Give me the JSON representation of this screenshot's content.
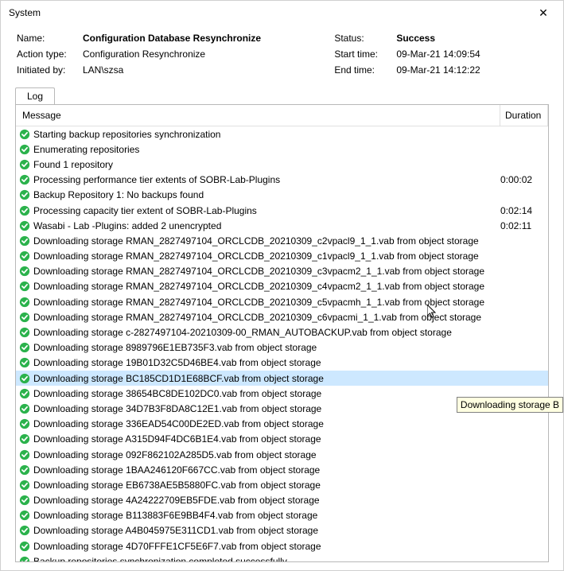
{
  "window": {
    "title": "System",
    "close": "✕"
  },
  "info": {
    "name_label": "Name:",
    "name_value": "Configuration Database Resynchronize",
    "action_label": "Action type:",
    "action_value": "Configuration Resynchronize",
    "init_label": "Initiated by:",
    "init_value": "LAN\\szsa",
    "status_label": "Status:",
    "status_value": "Success",
    "start_label": "Start time:",
    "start_value": "09-Mar-21 14:09:54",
    "end_label": "End time:",
    "end_value": "09-Mar-21 14:12:22"
  },
  "tab": {
    "label": "Log"
  },
  "columns": {
    "message": "Message",
    "duration": "Duration"
  },
  "rows": [
    {
      "msg": "Starting backup repositories synchronization",
      "dur": ""
    },
    {
      "msg": "Enumerating repositories",
      "dur": ""
    },
    {
      "msg": "Found 1 repository",
      "dur": ""
    },
    {
      "msg": "Processing performance tier extents of SOBR-Lab-Plugins",
      "dur": "0:00:02"
    },
    {
      "msg": "Backup Repository 1: No backups found",
      "dur": ""
    },
    {
      "msg": "Processing capacity tier extent of SOBR-Lab-Plugins",
      "dur": "0:02:14"
    },
    {
      "msg": "Wasabi - Lab -Plugins: added 2 unencrypted",
      "dur": "0:02:11"
    },
    {
      "msg": "Downloading storage RMAN_2827497104_ORCLCDB_20210309_c2vpacl9_1_1.vab from object storage",
      "dur": ""
    },
    {
      "msg": "Downloading storage RMAN_2827497104_ORCLCDB_20210309_c1vpacl9_1_1.vab from object storage",
      "dur": ""
    },
    {
      "msg": "Downloading storage RMAN_2827497104_ORCLCDB_20210309_c3vpacm2_1_1.vab from object storage",
      "dur": ""
    },
    {
      "msg": "Downloading storage RMAN_2827497104_ORCLCDB_20210309_c4vpacm2_1_1.vab from object storage",
      "dur": ""
    },
    {
      "msg": "Downloading storage RMAN_2827497104_ORCLCDB_20210309_c5vpacmh_1_1.vab from object storage",
      "dur": ""
    },
    {
      "msg": "Downloading storage RMAN_2827497104_ORCLCDB_20210309_c6vpacmi_1_1.vab from object storage",
      "dur": ""
    },
    {
      "msg": "Downloading storage c-2827497104-20210309-00_RMAN_AUTOBACKUP.vab from object storage",
      "dur": ""
    },
    {
      "msg": "Downloading storage 8989796E1EB735F3.vab from object storage",
      "dur": ""
    },
    {
      "msg": "Downloading storage 19B01D32C5D46BE4.vab from object storage",
      "dur": ""
    },
    {
      "msg": "Downloading storage BC185CD1D1E68BCF.vab from object storage",
      "dur": "",
      "selected": true
    },
    {
      "msg": "Downloading storage 38654BC8DE102DC0.vab from object storage",
      "dur": ""
    },
    {
      "msg": "Downloading storage 34D7B3F8DA8C12E1.vab from object storage",
      "dur": ""
    },
    {
      "msg": "Downloading storage 336EAD54C00DE2ED.vab from object storage",
      "dur": ""
    },
    {
      "msg": "Downloading storage A315D94F4DC6B1E4.vab from object storage",
      "dur": ""
    },
    {
      "msg": "Downloading storage 092F862102A285D5.vab from object storage",
      "dur": ""
    },
    {
      "msg": "Downloading storage 1BAA246120F667CC.vab from object storage",
      "dur": ""
    },
    {
      "msg": "Downloading storage EB6738AE5B5880FC.vab from object storage",
      "dur": ""
    },
    {
      "msg": "Downloading storage 4A24222709EB5FDE.vab from object storage",
      "dur": ""
    },
    {
      "msg": "Downloading storage B113883F6E9BB4F4.vab from object storage",
      "dur": ""
    },
    {
      "msg": "Downloading storage A4B045975E311CD1.vab from object storage",
      "dur": ""
    },
    {
      "msg": "Downloading storage 4D70FFFE1CF5E6F7.vab from object storage",
      "dur": ""
    },
    {
      "msg": "Backup repositories synchronization completed successfully",
      "dur": ""
    }
  ],
  "tooltip": "Downloading storage B"
}
